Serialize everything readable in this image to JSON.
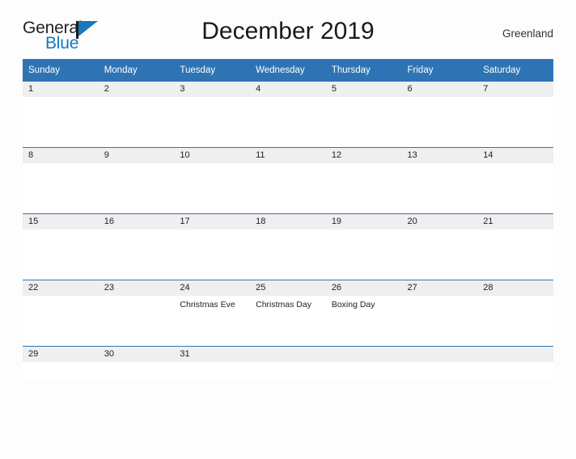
{
  "brand": {
    "name_part1": "General",
    "name_part2": "Blue",
    "flag_icon": "blue-triangle-flag-icon",
    "colors": {
      "text": "#231f20",
      "accent": "#1878be"
    }
  },
  "header": {
    "title": "December 2019",
    "locale": "Greenland"
  },
  "theme": {
    "header_bg": "#2e74b5",
    "header_text": "#ffffff",
    "daynum_bg": "#efefef",
    "row_border": "#2e74b5",
    "page_bg": "#fdfdfd"
  },
  "calendar": {
    "month": "December",
    "year": "2019",
    "weekday_headers": [
      "Sunday",
      "Monday",
      "Tuesday",
      "Wednesday",
      "Thursday",
      "Friday",
      "Saturday"
    ],
    "weeks": [
      [
        {
          "day": "1",
          "event": ""
        },
        {
          "day": "2",
          "event": ""
        },
        {
          "day": "3",
          "event": ""
        },
        {
          "day": "4",
          "event": ""
        },
        {
          "day": "5",
          "event": ""
        },
        {
          "day": "6",
          "event": ""
        },
        {
          "day": "7",
          "event": ""
        }
      ],
      [
        {
          "day": "8",
          "event": ""
        },
        {
          "day": "9",
          "event": ""
        },
        {
          "day": "10",
          "event": ""
        },
        {
          "day": "11",
          "event": ""
        },
        {
          "day": "12",
          "event": ""
        },
        {
          "day": "13",
          "event": ""
        },
        {
          "day": "14",
          "event": ""
        }
      ],
      [
        {
          "day": "15",
          "event": ""
        },
        {
          "day": "16",
          "event": ""
        },
        {
          "day": "17",
          "event": ""
        },
        {
          "day": "18",
          "event": ""
        },
        {
          "day": "19",
          "event": ""
        },
        {
          "day": "20",
          "event": ""
        },
        {
          "day": "21",
          "event": ""
        }
      ],
      [
        {
          "day": "22",
          "event": ""
        },
        {
          "day": "23",
          "event": ""
        },
        {
          "day": "24",
          "event": "Christmas Eve"
        },
        {
          "day": "25",
          "event": "Christmas Day"
        },
        {
          "day": "26",
          "event": "Boxing Day"
        },
        {
          "day": "27",
          "event": ""
        },
        {
          "day": "28",
          "event": ""
        }
      ],
      [
        {
          "day": "29",
          "event": ""
        },
        {
          "day": "30",
          "event": ""
        },
        {
          "day": "31",
          "event": ""
        },
        {
          "day": "",
          "event": ""
        },
        {
          "day": "",
          "event": ""
        },
        {
          "day": "",
          "event": ""
        },
        {
          "day": "",
          "event": ""
        }
      ]
    ]
  }
}
